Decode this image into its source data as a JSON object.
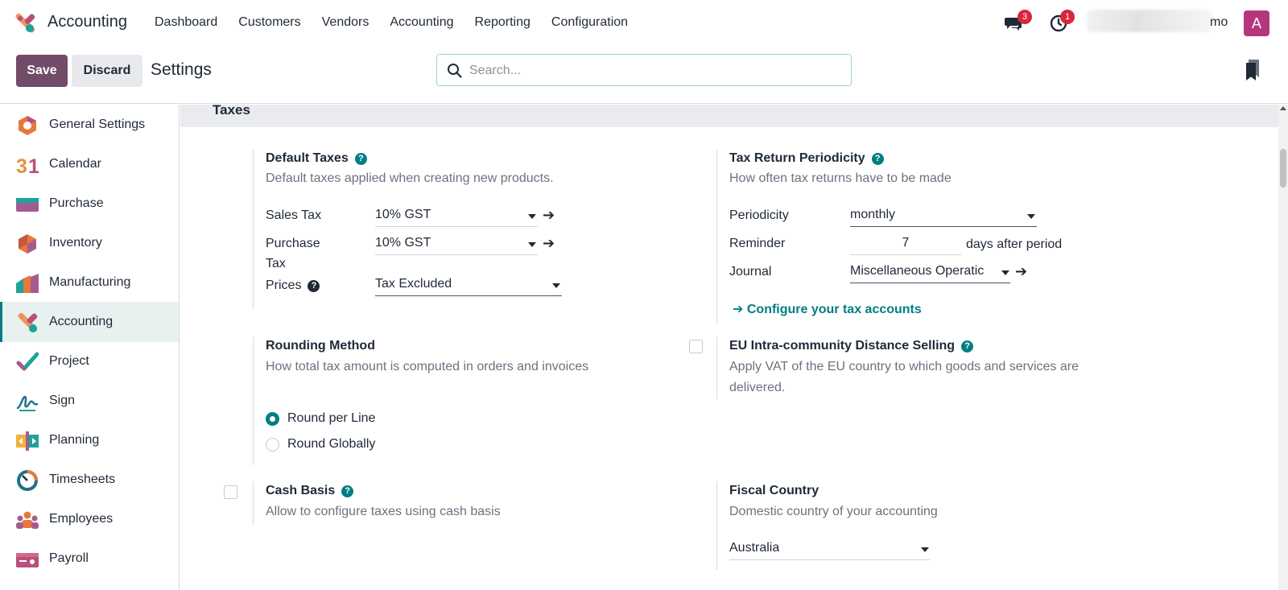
{
  "topnav": {
    "app_name": "Accounting",
    "menu": [
      "Dashboard",
      "Customers",
      "Vendors",
      "Accounting",
      "Reporting",
      "Configuration"
    ],
    "messages_badge": "3",
    "activity_badge": "1",
    "user_name_tail": "mo",
    "avatar_letter": "A"
  },
  "control": {
    "save_label": "Save",
    "discard_label": "Discard",
    "title": "Settings",
    "search_placeholder": "Search..."
  },
  "sidebar": {
    "items": [
      {
        "label": "General Settings",
        "icon": "general-settings-icon"
      },
      {
        "label": "Calendar",
        "icon": "calendar-icon"
      },
      {
        "label": "Purchase",
        "icon": "purchase-icon"
      },
      {
        "label": "Inventory",
        "icon": "inventory-icon"
      },
      {
        "label": "Manufacturing",
        "icon": "manufacturing-icon"
      },
      {
        "label": "Accounting",
        "icon": "accounting-icon",
        "active": true
      },
      {
        "label": "Project",
        "icon": "project-icon"
      },
      {
        "label": "Sign",
        "icon": "sign-icon"
      },
      {
        "label": "Planning",
        "icon": "planning-icon"
      },
      {
        "label": "Timesheets",
        "icon": "timesheets-icon"
      },
      {
        "label": "Employees",
        "icon": "employees-icon"
      },
      {
        "label": "Payroll",
        "icon": "payroll-icon"
      }
    ]
  },
  "section": {
    "title": "Taxes"
  },
  "default_taxes": {
    "title": "Default Taxes",
    "desc": "Default taxes applied when creating new products.",
    "sales_tax_label": "Sales Tax",
    "sales_tax_value": "10% GST",
    "purchase_tax_label_1": "Purchase",
    "purchase_tax_label_2": "Tax",
    "purchase_tax_value": "10% GST",
    "prices_label": "Prices",
    "prices_value": "Tax Excluded"
  },
  "tax_return": {
    "title": "Tax Return Periodicity",
    "desc": "How often tax returns have to be made",
    "periodicity_label": "Periodicity",
    "periodicity_value": "monthly",
    "reminder_label": "Reminder",
    "reminder_value": "7",
    "reminder_suffix": "days after period",
    "journal_label": "Journal",
    "journal_value": "Miscellaneous Operatic",
    "configure_link": "Configure your tax accounts"
  },
  "rounding": {
    "title": "Rounding Method",
    "desc": "How total tax amount is computed in orders and invoices",
    "options": [
      "Round per Line",
      "Round Globally"
    ],
    "selected": "Round per Line"
  },
  "eu_distance": {
    "title": "EU Intra-community Distance Selling",
    "desc_1": "Apply VAT of the EU country to which goods and services are",
    "desc_2": "delivered.",
    "checked": false
  },
  "cash_basis": {
    "title": "Cash Basis",
    "desc": "Allow to configure taxes using cash basis",
    "checked": false
  },
  "fiscal_country": {
    "title": "Fiscal Country",
    "desc": "Domestic country of your accounting",
    "value": "Australia"
  },
  "colors": {
    "brand": "#714b67",
    "accent": "#017e84",
    "badge": "#d9263a",
    "avatar": "#b5367c"
  }
}
